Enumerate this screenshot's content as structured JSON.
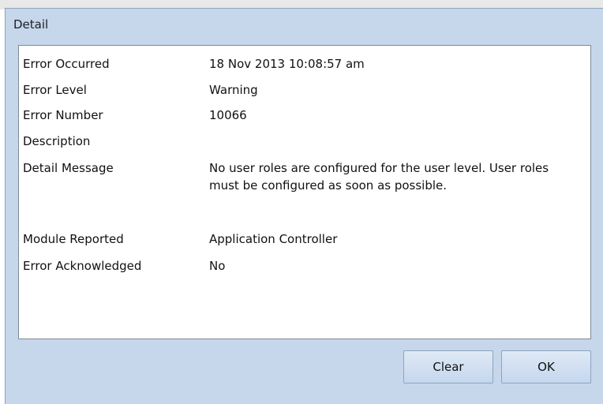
{
  "dialog": {
    "title": "Detail",
    "fields": [
      {
        "label": "Error Occurred",
        "value": "18 Nov 2013 10:08:57 am"
      },
      {
        "label": "Error Level",
        "value": "Warning"
      },
      {
        "label": "Error Number",
        "value": "10066"
      },
      {
        "label": "Description",
        "value": ""
      },
      {
        "label": "Detail Message",
        "value": "No user roles are configured for the user level. User roles must be configured as soon as possible."
      },
      {
        "label": "Module Reported",
        "value": "Application Controller"
      },
      {
        "label": "Error Acknowledged",
        "value": "No"
      }
    ],
    "buttons": {
      "clear": "Clear",
      "ok": "OK"
    }
  },
  "colors": {
    "window_bg": "#c6d7ec",
    "panel_bg": "#ffffff",
    "panel_border": "#7f8a97",
    "button_border": "#8ea3bd"
  }
}
